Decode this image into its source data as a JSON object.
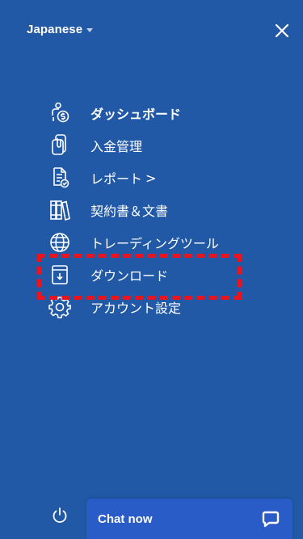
{
  "language": {
    "label": "Japanese",
    "icon": "chevron-down-icon"
  },
  "close_icon": "close-icon",
  "menu": {
    "items": [
      {
        "label": "ダッシュボード",
        "icon": "dashboard-person-dollar-icon"
      },
      {
        "label": "入金管理",
        "icon": "funds-management-icon"
      },
      {
        "label": "レポート",
        "suffix": ">",
        "icon": "report-document-icon"
      },
      {
        "label": "契約書＆文書",
        "icon": "contracts-binders-icon"
      },
      {
        "label": "トレーディングツール",
        "icon": "globe-tools-icon"
      },
      {
        "label": "ダウンロード",
        "icon": "download-icon"
      },
      {
        "label": "アカウント設定",
        "icon": "gear-icon"
      }
    ]
  },
  "highlight_color": "#e8141f",
  "background_color": "#2159a7",
  "footer": {
    "power_icon": "power-icon",
    "chat": {
      "label": "Chat now",
      "icon": "chat-bubble-icon",
      "color": "#2a5cc8"
    }
  }
}
